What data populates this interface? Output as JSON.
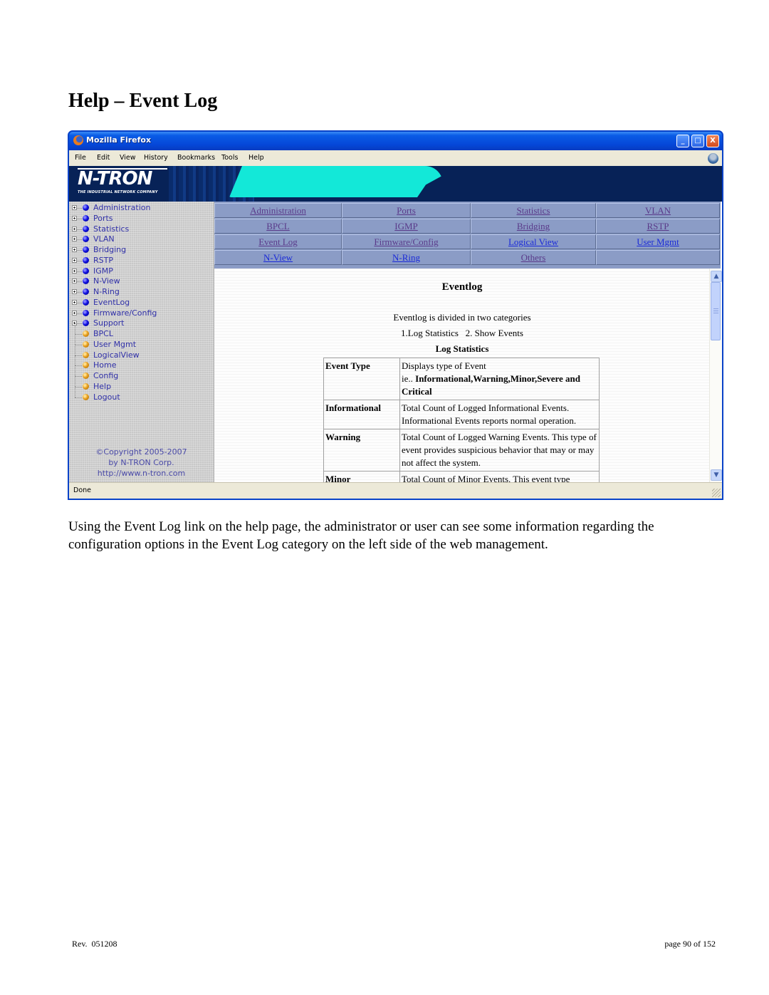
{
  "document": {
    "title": "Help – Event Log",
    "body": "Using the Event Log link on the help page, the administrator or user can see some information regarding the configuration options in the Event Log category on the left side of the web management.",
    "footer_rev": "Rev.  051208",
    "footer_page": "page 90 of 152"
  },
  "browser": {
    "window_title": "Mozilla Firefox",
    "window_buttons": {
      "minimize": "_",
      "maximize": "□",
      "close": "X"
    },
    "menu": [
      "File",
      "Edit",
      "View",
      "History",
      "Bookmarks",
      "Tools",
      "Help"
    ],
    "status": "Done"
  },
  "banner": {
    "logo": "N-TRON",
    "tagline": "THE INDUSTRIAL NETWORK COMPANY"
  },
  "sidebar": {
    "items": [
      {
        "label": "Administration",
        "icon": "blue-bullet",
        "expandable": true
      },
      {
        "label": "Ports",
        "icon": "blue-bullet",
        "expandable": true
      },
      {
        "label": "Statistics",
        "icon": "blue-bullet",
        "expandable": true
      },
      {
        "label": "VLAN",
        "icon": "blue-bullet",
        "expandable": true
      },
      {
        "label": "Bridging",
        "icon": "blue-bullet",
        "expandable": true
      },
      {
        "label": "RSTP",
        "icon": "blue-bullet",
        "expandable": true
      },
      {
        "label": "IGMP",
        "icon": "blue-bullet",
        "expandable": true
      },
      {
        "label": "N-View",
        "icon": "blue-bullet",
        "expandable": true
      },
      {
        "label": "N-Ring",
        "icon": "blue-bullet",
        "expandable": true
      },
      {
        "label": "EventLog",
        "icon": "blue-bullet",
        "expandable": true
      },
      {
        "label": "Firmware/Config",
        "icon": "blue-bullet",
        "expandable": true
      },
      {
        "label": "Support",
        "icon": "blue-bullet",
        "expandable": true
      },
      {
        "label": "BPCL",
        "icon": "orange-bullet",
        "expandable": false
      },
      {
        "label": "User Mgmt",
        "icon": "orange-bullet",
        "expandable": false
      },
      {
        "label": "LogicalView",
        "icon": "orange-bullet",
        "expandable": false
      },
      {
        "label": "Home",
        "icon": "orange-bullet",
        "expandable": false
      },
      {
        "label": "Config",
        "icon": "orange-bullet",
        "expandable": false
      },
      {
        "label": "Help",
        "icon": "orange-bullet",
        "expandable": false
      },
      {
        "label": "Logout",
        "icon": "orange-bullet",
        "expandable": false
      }
    ],
    "copyright": [
      "©Copyright 2005-2007",
      "by N-TRON Corp.",
      "http://www.n-tron.com"
    ]
  },
  "nav_links": [
    [
      {
        "label": "Administration",
        "visited": true
      },
      {
        "label": "Ports",
        "visited": true
      },
      {
        "label": "Statistics",
        "visited": true
      },
      {
        "label": "VLAN",
        "visited": true
      }
    ],
    [
      {
        "label": "BPCL",
        "visited": true
      },
      {
        "label": "IGMP",
        "visited": true
      },
      {
        "label": "Bridging",
        "visited": true
      },
      {
        "label": "RSTP",
        "visited": true
      }
    ],
    [
      {
        "label": "Event Log",
        "visited": true
      },
      {
        "label": "Firmware/Config",
        "visited": true
      },
      {
        "label": "Logical View",
        "visited": false
      },
      {
        "label": "User Mgmt",
        "visited": false
      }
    ],
    [
      {
        "label": "N-View",
        "visited": false
      },
      {
        "label": "N-Ring",
        "visited": false
      },
      {
        "label": "Others",
        "visited": true
      },
      {
        "label": "",
        "visited": false
      }
    ]
  ],
  "help_content": {
    "heading": "Eventlog",
    "intro": "Eventlog is divided in two categories",
    "categories": "1.Log Statistics   2. Show Events",
    "subheading": "Log Statistics",
    "table": [
      {
        "type": "Event Type",
        "desc": "Displays type of Event",
        "desc_prefix": "ie.. ",
        "desc_bold": "Informational,Warning,Minor,Severe and Critical"
      },
      {
        "type": "Informational",
        "desc": "Total Count of Logged Informational Events. Informational Events reports normal operation."
      },
      {
        "type": "Warning",
        "desc": "Total Count of Logged Warning Events. This type of event provides suspicious behavior that may or may not affect the system."
      },
      {
        "type": "Minor",
        "desc": "Total Count of Minor Events. This event type"
      }
    ]
  },
  "colors": {
    "titlebar": "#0a5ce6",
    "banner_bg": "#072257",
    "banner_accent": "#13e8d8",
    "nav_bg": "#8b9cc6",
    "link_visited": "#5a3a8a",
    "link_unvisited": "#1a2ad8",
    "sidebar_text": "#3030a8"
  }
}
